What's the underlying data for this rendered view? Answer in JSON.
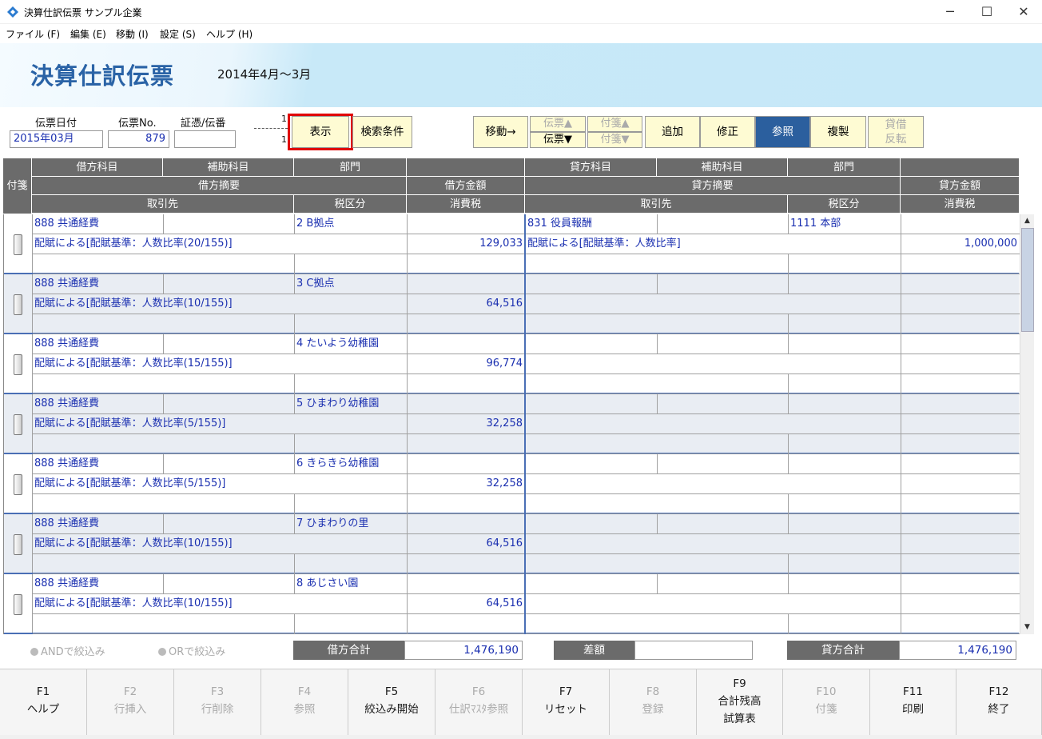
{
  "window": {
    "title": "決算仕訳伝票 サンプル企業",
    "minimize": "─",
    "maximize": "☐",
    "close": "✕"
  },
  "menu": [
    "ファイル (F)",
    "編集 (E)",
    "移動 (I)",
    "設定 (S)",
    "ヘルプ (H)"
  ],
  "page": {
    "title": "決算仕訳伝票",
    "period": "2014年4月～3月"
  },
  "header_fields": {
    "date_label": "伝票日付",
    "date_value": "2015年03月",
    "no_label": "伝票No.",
    "no_value": "879",
    "voucher_label": "証憑/伝番",
    "voucher_value": "",
    "marker_top": "1",
    "marker_bottom": "1"
  },
  "buttons": {
    "display": "表示",
    "search": "検索条件",
    "move": "移動→",
    "voucher_up": "伝票▲",
    "voucher_down": "伝票▼",
    "tag_up": "付箋▲",
    "tag_down": "付箋▼",
    "add": "追加",
    "edit": "修正",
    "view": "参照",
    "copy": "複製",
    "reverse_1": "貸借",
    "reverse_2": "反転"
  },
  "grid_headers": {
    "fusen": "付箋",
    "dr_account": "借方科目",
    "dr_sub": "補助科目",
    "dr_dept": "部門",
    "dr_summary": "借方摘要",
    "dr_amount": "借方金額",
    "dr_partner": "取引先",
    "dr_tax": "税区分",
    "dr_ctax": "消費税",
    "cr_account": "貸方科目",
    "cr_sub": "補助科目",
    "cr_dept": "部門",
    "cr_summary": "貸方摘要",
    "cr_amount": "貸方金額",
    "cr_partner": "取引先",
    "cr_tax": "税区分",
    "cr_ctax": "消費税"
  },
  "rows": [
    {
      "dr_account": "888 共通経費",
      "dr_dept": "2 B拠点",
      "dr_summary": "配賦による[配賦基準：人数比率(20/155)]",
      "dr_amount": "129,033",
      "cr_account": "831 役員報酬",
      "cr_dept": "1111 本部",
      "cr_summary": "配賦による[配賦基準：人数比率]",
      "cr_amount": "1,000,000"
    },
    {
      "dr_account": "888 共通経費",
      "dr_dept": "3 C拠点",
      "dr_summary": "配賦による[配賦基準：人数比率(10/155)]",
      "dr_amount": "64,516"
    },
    {
      "dr_account": "888 共通経費",
      "dr_dept": "4 たいよう幼稚園",
      "dr_summary": "配賦による[配賦基準：人数比率(15/155)]",
      "dr_amount": "96,774"
    },
    {
      "dr_account": "888 共通経費",
      "dr_dept": "5 ひまわり幼稚園",
      "dr_summary": "配賦による[配賦基準：人数比率(5/155)]",
      "dr_amount": "32,258"
    },
    {
      "dr_account": "888 共通経費",
      "dr_dept": "6 きらきら幼稚園",
      "dr_summary": "配賦による[配賦基準：人数比率(5/155)]",
      "dr_amount": "32,258"
    },
    {
      "dr_account": "888 共通経費",
      "dr_dept": "7 ひまわりの里",
      "dr_summary": "配賦による[配賦基準：人数比率(10/155)]",
      "dr_amount": "64,516"
    },
    {
      "dr_account": "888 共通経費",
      "dr_dept": "8 あじさい園",
      "dr_summary": "配賦による[配賦基準：人数比率(10/155)]",
      "dr_amount": "64,516"
    }
  ],
  "filters": {
    "and": "ANDで絞込み",
    "or": "ORで絞込み"
  },
  "totals": {
    "dr_label": "借方合計",
    "dr_value": "1,476,190",
    "diff_label": "差額",
    "diff_value": "",
    "cr_label": "貸方合計",
    "cr_value": "1,476,190"
  },
  "fkeys": [
    {
      "key": "F1",
      "label": "ヘルプ",
      "enabled": true
    },
    {
      "key": "F2",
      "label": "行挿入",
      "enabled": false
    },
    {
      "key": "F3",
      "label": "行削除",
      "enabled": false
    },
    {
      "key": "F4",
      "label": "参照",
      "enabled": false
    },
    {
      "key": "F5",
      "label": "絞込み開始",
      "enabled": true
    },
    {
      "key": "F6",
      "label": "仕訳ﾏｽﾀ参照",
      "enabled": false
    },
    {
      "key": "F7",
      "label": "リセット",
      "enabled": true
    },
    {
      "key": "F8",
      "label": "登録",
      "enabled": false
    },
    {
      "key": "F9",
      "label": "合計残高",
      "label2": "試算表",
      "enabled": true
    },
    {
      "key": "F10",
      "label": "付箋",
      "enabled": false
    },
    {
      "key": "F11",
      "label": "印刷",
      "enabled": true
    },
    {
      "key": "F12",
      "label": "終了",
      "enabled": true
    }
  ],
  "colors": {
    "accent": "#2b5f9e",
    "title": "#2a63a6",
    "button_bg": "#fefbd3",
    "highlight": "#e00000",
    "grid_header": "#6b6b6b",
    "text_blue": "#1a2fb0"
  }
}
